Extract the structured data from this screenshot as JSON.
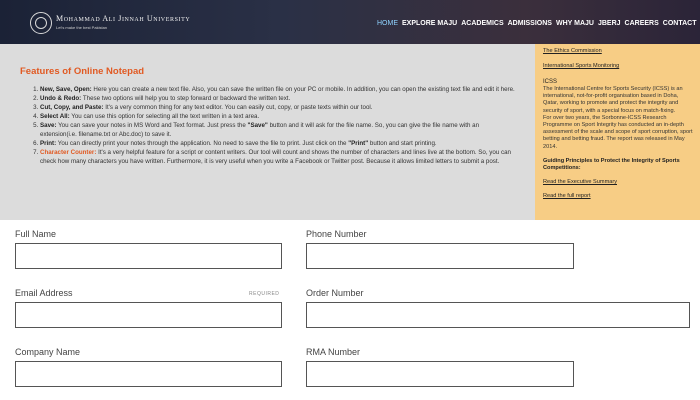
{
  "header": {
    "university_name": "Mohammad Ali Jinnah University",
    "university_sub": "Let's make the best Pakistan",
    "nav": [
      "HOME",
      "EXPLORE MAJU",
      "ACADEMICS",
      "ADMISSIONS",
      "WHY MAJU",
      "JBERJ",
      "CAREERS",
      "CONTACT"
    ]
  },
  "notepad": {
    "title": "Features of Online Notepad",
    "items": [
      {
        "bold": "New, Save, Open:",
        "text": " Here you can create a new text file. Also, you can save the written file on your PC or mobile. In addition, you can open the existing text file and edit it here."
      },
      {
        "bold": "Undo & Redo:",
        "text": " These two options will help you to step forward or backward the written text."
      },
      {
        "bold": "Cut, Copy, and Paste:",
        "text": " It's a very common thing for any text editor. You can easily cut, copy, or paste texts within our tool."
      },
      {
        "bold": "Select All:",
        "text": " You can use this option for selecting all the text written in a text area."
      },
      {
        "bold": "Save:",
        "text_a": " You can save your notes in MS Word and Text format. Just press the ",
        "bold_b": "\"Save\"",
        "text_b": " button and it will ask for the file name. So, you can give the file name with an extension(i.e. filename.txt or Abc.doc) to save it."
      },
      {
        "bold": "Print:",
        "text_a": " You can directly print your notes through the application. No need to save the file to print. Just click on the ",
        "bold_b": "\"Print\"",
        "text_b": " button and start printing."
      },
      {
        "bold": "Character Counter:",
        "text": " It's a very helpful feature for a script or content writers. Our tool will count and shows the number of characters and lines live at the bottom. So, you can check how many characters you have written. Furthermore, it is very useful when you write a Facebook or Twitter post. Because it allows limited letters to submit a post."
      }
    ]
  },
  "sidebar": {
    "link_ethics": "The Ethics Commission",
    "link_monitoring": "International Sports Monitoring",
    "heading": "ICSS",
    "para1": "The International Centre for Sports Security (ICSS) is an international, not-for-profit organisation based in Doha, Qatar, working to promote and protect the integrity and security of sport, with a special focus on match-fixing.",
    "para2": "For over two years, the Sorbonne-ICSS Research Programme on Sport Integrity has conducted an in-depth assessment of the scale and scope of sport corruption, sport betting and betting fraud. The report was released in May 2014.",
    "bold_heading": "Guiding Principles to Protect the Integrity of Sports Competitions:",
    "link_exec": "Read the Executive Summary",
    "link_full": "Read the full report"
  },
  "form": {
    "full_name_label": "Full Name",
    "phone_label": "Phone Number",
    "email_label": "Email Address",
    "required_label": "REQUIRED",
    "order_label": "Order Number",
    "company_label": "Company Name",
    "rma_label": "RMA Number"
  },
  "colors": {
    "accent_orange": "#e15a23",
    "sidebar_bg": "#f7cd85",
    "panel_bg": "#dcdcdc",
    "nav_active": "#8fd3ff"
  }
}
